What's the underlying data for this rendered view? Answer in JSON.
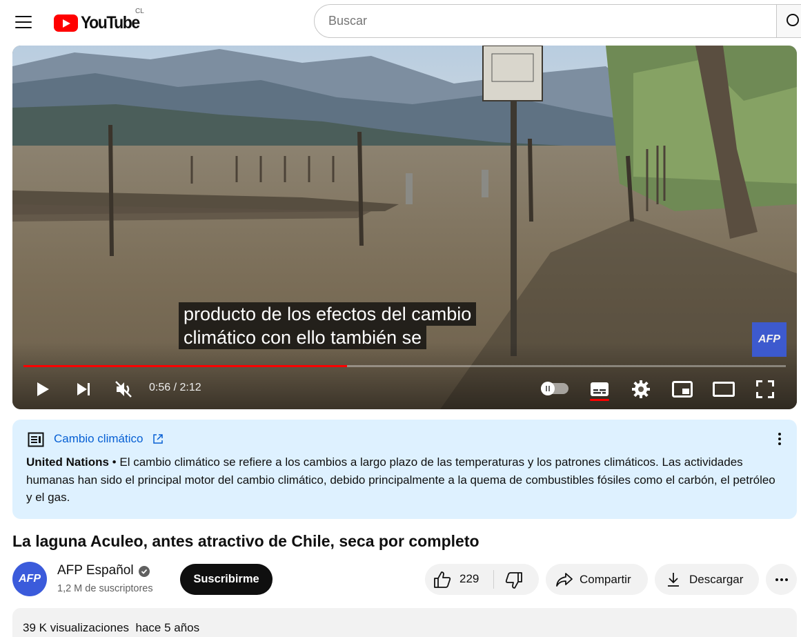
{
  "header": {
    "logo_text": "YouTube",
    "country_code": "CL",
    "search_placeholder": "Buscar"
  },
  "player": {
    "caption_lines": [
      "producto de los efectos del cambio",
      "climático con ello también se"
    ],
    "watermark": "AFP",
    "current_time": "0:56",
    "duration": "2:12",
    "time_display": "0:56 / 2:12",
    "progress_fraction": 0.424,
    "muted": true,
    "captions_on": true
  },
  "info_panel": {
    "topic": "Cambio climático",
    "source": "United Nations",
    "separator": " • ",
    "text": "El cambio climático se refiere a los cambios a largo plazo de las temperaturas y los patrones climáticos. Las actividades humanas han sido el principal motor del cambio climático, debido principalmente a la quema de combustibles fósiles como el carbón, el petróleo y el gas."
  },
  "video": {
    "title": "La laguna Aculeo, antes atractivo de Chile, seca por completo",
    "channel_name": "AFP Español",
    "channel_avatar_text": "AFP",
    "subscribers": "1,2 M de suscriptores",
    "subscribe_label": "Suscribirme",
    "likes": "229",
    "share_label": "Compartir",
    "download_label": "Descargar",
    "views": "39 K visualizaciones",
    "published": "hace 5 años"
  },
  "colors": {
    "brand_red": "#ff0000",
    "info_bg": "#def1ff",
    "link_blue": "#065fd4",
    "afp_blue": "#3b5bdb",
    "pill_bg": "#f2f2f2"
  }
}
